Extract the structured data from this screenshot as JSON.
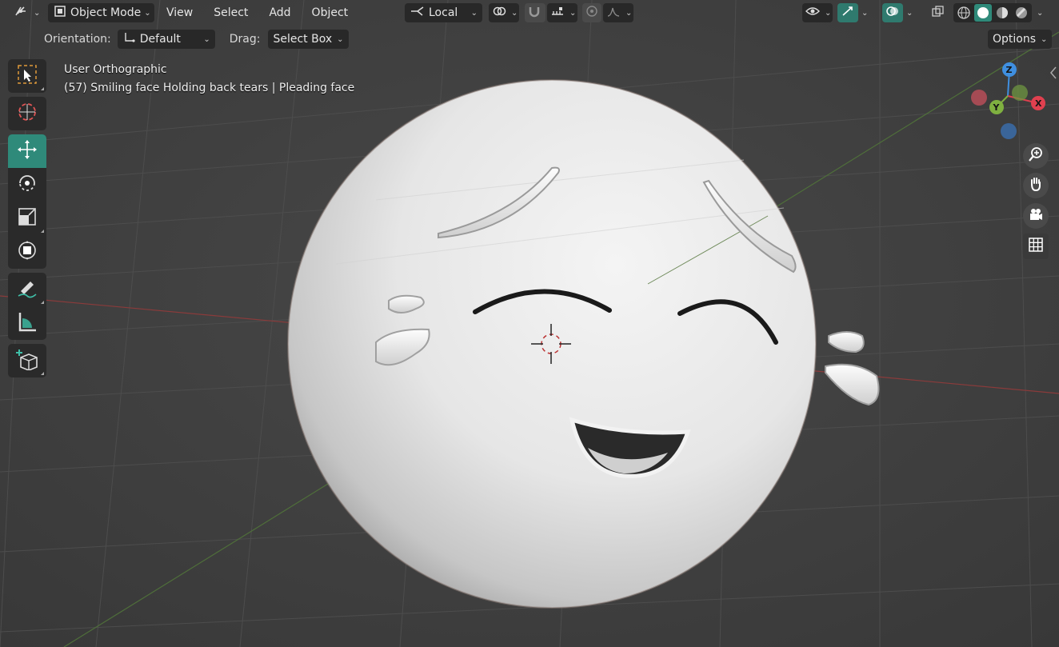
{
  "header": {
    "editor_type_icon": "editor-type-icon",
    "mode_label": "Object Mode",
    "menus": [
      "View",
      "Select",
      "Add",
      "Object"
    ],
    "transform_orientation": "Local",
    "pivot_icon": "link-icon",
    "snap_icon": "magnet-icon",
    "proportional_icon": "proportional-edit-icon",
    "shading_modes": [
      "wireframe",
      "solid",
      "material-preview",
      "rendered"
    ],
    "active_shading": "solid"
  },
  "tool_settings": {
    "orientation_label": "Orientation:",
    "orientation_value": "Default",
    "drag_label": "Drag:",
    "drag_value": "Select Box",
    "options_label": "Options"
  },
  "overlay": {
    "view_name": "User Orthographic",
    "object_info": "(57) Smiling face Holding back tears | Pleading face"
  },
  "toolbar": {
    "tools": [
      "select-box",
      "cursor",
      "move",
      "rotate",
      "scale",
      "transform",
      "annotate",
      "measure",
      "add-cube"
    ],
    "active_tool": "move"
  },
  "gizmo": {
    "x_label": "X",
    "y_label": "Y",
    "z_label": "Z",
    "x_color": "#e0404f",
    "y_color": "#7fb040",
    "z_color": "#3f8fe0"
  },
  "nav_buttons": [
    "zoom-icon",
    "hand-pan-icon",
    "camera-icon",
    "grid-icon"
  ],
  "colors": {
    "accent": "#2f8a7a",
    "viewport_bg": "#404040"
  }
}
